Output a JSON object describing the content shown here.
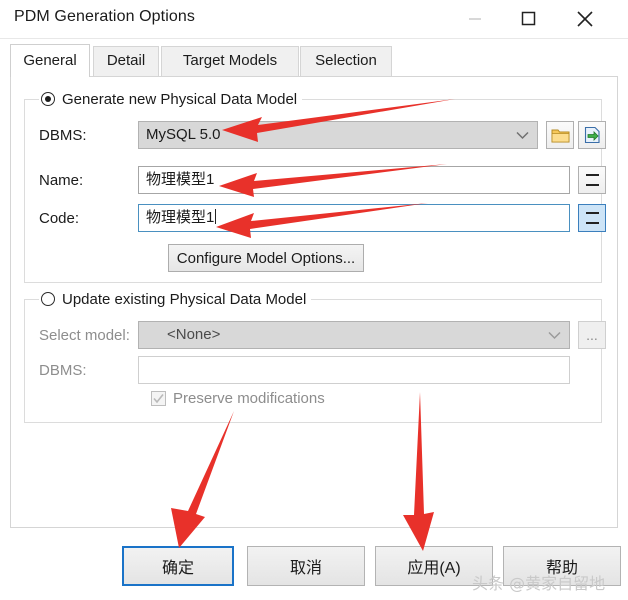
{
  "window": {
    "title": "PDM Generation Options",
    "controls": {
      "minimize": "minimize-icon",
      "maximize": "maximize-icon",
      "close": "close-icon"
    }
  },
  "tabs": [
    {
      "label": "General",
      "active": true
    },
    {
      "label": "Detail",
      "active": false
    },
    {
      "label": "Target Models",
      "active": false
    },
    {
      "label": "Selection",
      "active": false
    }
  ],
  "generate_group": {
    "legend": "Generate new Physical Data Model",
    "selected": true,
    "dbms": {
      "label": "DBMS:",
      "value": "MySQL 5.0",
      "dropdown_icon": "chevron-down-icon",
      "browse_icon": "folder-icon",
      "import_icon": "import-model-icon"
    },
    "name": {
      "label": "Name:",
      "value": "物理模型1",
      "equal_button": "="
    },
    "code": {
      "label": "Code:",
      "value": "物理模型1",
      "focused": true,
      "equal_button": "="
    },
    "configure_button": "Configure Model Options..."
  },
  "update_group": {
    "legend": "Update existing Physical Data Model",
    "selected": false,
    "select_model": {
      "label": "Select model:",
      "value": "<None>",
      "dropdown_icon": "chevron-down-icon",
      "browse_button": "..."
    },
    "dbms": {
      "label": "DBMS:",
      "value": ""
    },
    "preserve": {
      "label": "Preserve modifications",
      "checked": true,
      "enabled": false
    }
  },
  "footer": {
    "ok": "确定",
    "cancel": "取消",
    "apply": "应用(A)",
    "help": "帮助"
  },
  "watermark": "头条 @黄家自留地",
  "annotation": {
    "color": "#e8312a",
    "arrow_count": 5,
    "targets": [
      "dbms-field",
      "name-field",
      "code-field",
      "ok-button",
      "apply-button"
    ]
  }
}
